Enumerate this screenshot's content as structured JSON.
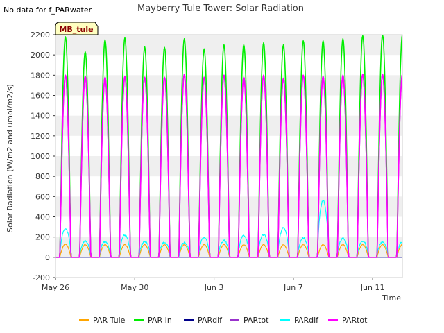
{
  "chart_data": {
    "type": "line",
    "title": "Mayberry Tule Tower: Solar Radiation",
    "xlabel": "Time",
    "ylabel": "Solar Radiation (W/m2 and umol/m2/s)",
    "ylim": [
      -200,
      2200
    ],
    "yticks": [
      -200,
      0,
      200,
      400,
      600,
      800,
      1000,
      1200,
      1400,
      1600,
      1800,
      2000,
      2200
    ],
    "x_range": [
      "2023-05-26",
      "2023-06-12"
    ],
    "xtick_labels": [
      "May 26",
      "May 30",
      "Jun 3",
      "Jun 7",
      "Jun 11"
    ],
    "grid": "horizontal bands",
    "legend_position": "bottom",
    "no_data_note": "No data for f_PARwater",
    "station_tag": "MB_tule",
    "days": [
      "May 26",
      "May 27",
      "May 28",
      "May 29",
      "May 30",
      "May 31",
      "Jun 1",
      "Jun 2",
      "Jun 3",
      "Jun 4",
      "Jun 5",
      "Jun 6",
      "Jun 7",
      "Jun 8",
      "Jun 9",
      "Jun 10",
      "Jun 11",
      "Jun 12"
    ],
    "series": [
      {
        "name": "PAR Tule",
        "color": "#FFA500",
        "daily_peak": [
          130,
          125,
          125,
          125,
          125,
          125,
          125,
          125,
          125,
          125,
          125,
          125,
          125,
          125,
          125,
          125,
          125,
          125
        ]
      },
      {
        "name": "PAR In",
        "color": "#00EE00",
        "daily_peak": [
          2180,
          2030,
          2150,
          2170,
          2080,
          2075,
          2160,
          2060,
          2100,
          2100,
          2120,
          2100,
          2140,
          2140,
          2160,
          2190,
          2200,
          2200
        ]
      },
      {
        "name": "PARdif",
        "color": "#00008B",
        "daily_peak": [
          0,
          0,
          0,
          0,
          0,
          0,
          0,
          0,
          0,
          0,
          0,
          0,
          0,
          0,
          0,
          0,
          0,
          0
        ]
      },
      {
        "name": "PARtot",
        "color": "#9932CC",
        "daily_peak": [
          1800,
          1790,
          1780,
          1790,
          1780,
          1780,
          1810,
          1780,
          1800,
          1780,
          1800,
          1770,
          1800,
          1790,
          1800,
          1810,
          1810,
          1810
        ]
      },
      {
        "name": "PARdif",
        "color": "#00FFFF",
        "daily_peak": [
          280,
          160,
          155,
          220,
          155,
          150,
          145,
          195,
          165,
          215,
          225,
          290,
          190,
          560,
          185,
          160,
          150,
          150
        ]
      },
      {
        "name": "PARtot",
        "color": "#FF00FF",
        "daily_peak": [
          1800,
          1790,
          1780,
          1790,
          1780,
          1780,
          1810,
          1780,
          1800,
          1780,
          1800,
          1770,
          1800,
          1790,
          1800,
          1810,
          1810,
          1810
        ]
      }
    ]
  }
}
